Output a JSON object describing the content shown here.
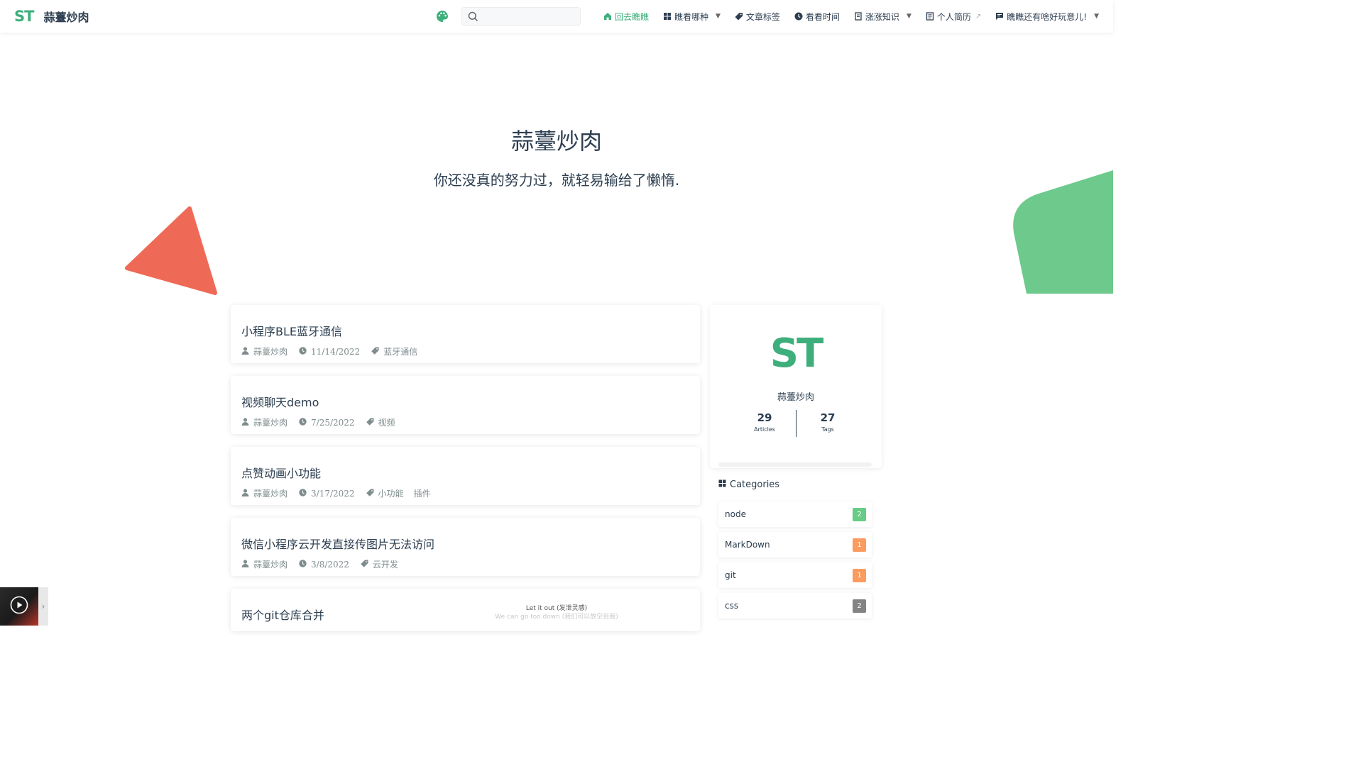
{
  "navbar": {
    "logo": "ST",
    "site_title": "蒜薹炒肉",
    "search_placeholder": "",
    "items": [
      {
        "label": "回去瞧瞧",
        "icon": "home-icon",
        "active": true,
        "dropdown": false
      },
      {
        "label": "瞧看哪种",
        "icon": "grid-icon",
        "active": false,
        "dropdown": true
      },
      {
        "label": "文章标签",
        "icon": "tag-icon",
        "active": false,
        "dropdown": false
      },
      {
        "label": "看看时间",
        "icon": "clock-icon",
        "active": false,
        "dropdown": false
      },
      {
        "label": "涨涨知识",
        "icon": "book-icon",
        "active": false,
        "dropdown": true
      },
      {
        "label": "个人简历",
        "icon": "doc-icon",
        "active": false,
        "dropdown": false,
        "external": true
      },
      {
        "label": "瞧瞧还有啥好玩意儿!",
        "icon": "chat-icon",
        "active": false,
        "dropdown": true
      }
    ]
  },
  "hero": {
    "title": "蒜薹炒肉",
    "description": "你还没真的努力过，就轻易输给了懒惰."
  },
  "articles": [
    {
      "title": "小程序BLE蓝牙通信",
      "author": "蒜薹炒肉",
      "date": "11/14/2022",
      "tags": [
        "蓝牙通信"
      ]
    },
    {
      "title": "视频聊天demo",
      "author": "蒜薹炒肉",
      "date": "7/25/2022",
      "tags": [
        "视频"
      ]
    },
    {
      "title": "点赞动画小功能",
      "author": "蒜薹炒肉",
      "date": "3/17/2022",
      "tags": [
        "小功能",
        "插件"
      ]
    },
    {
      "title": "微信小程序云开发直接传图片无法访问",
      "author": "蒜薹炒肉",
      "date": "3/8/2022",
      "tags": [
        "云开发"
      ]
    },
    {
      "title": "两个git仓库合并",
      "author": "",
      "date": "",
      "tags": []
    }
  ],
  "profile": {
    "avatar_text": "ST",
    "name": "蒜薹炒肉",
    "articles_count": "29",
    "articles_label": "Articles",
    "tags_count": "27",
    "tags_label": "Tags"
  },
  "categories": {
    "heading": "Categories",
    "items": [
      {
        "name": "node",
        "count": "2",
        "color": "#67cc86"
      },
      {
        "name": "MarkDown",
        "count": "1",
        "color": "#fb9b5f"
      },
      {
        "name": "git",
        "count": "1",
        "color": "#fb9b5f"
      },
      {
        "name": "css",
        "count": "2",
        "color": "#838383"
      }
    ]
  },
  "player": {
    "lyric_line1": "Let it out (发泄灵感)",
    "lyric_line2": "We can go too down (我们可以放空自我)"
  },
  "colors": {
    "accent": "#3eaf7c",
    "triangle": "#ef6a56",
    "green_shape": "#6dc98c"
  }
}
